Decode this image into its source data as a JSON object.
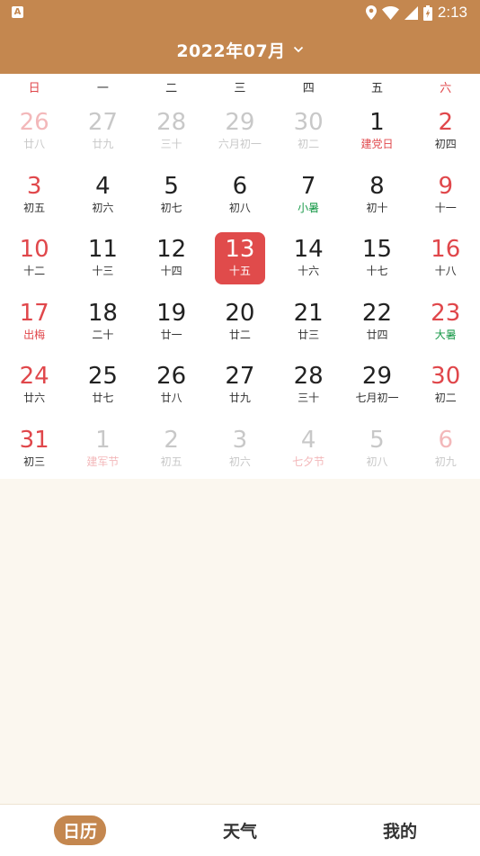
{
  "status": {
    "app_badge": "A",
    "time": "2:13"
  },
  "header": {
    "title": "2022年07月"
  },
  "weekdays": [
    "日",
    "一",
    "二",
    "三",
    "四",
    "五",
    "六"
  ],
  "days": [
    {
      "n": "26",
      "l": "廿八",
      "faded": true
    },
    {
      "n": "27",
      "l": "廿九",
      "faded": true
    },
    {
      "n": "28",
      "l": "三十",
      "faded": true
    },
    {
      "n": "29",
      "l": "六月初一",
      "faded": true
    },
    {
      "n": "30",
      "l": "初二",
      "faded": true
    },
    {
      "n": "1",
      "l": "建党日",
      "type": "fest"
    },
    {
      "n": "2",
      "l": "初四"
    },
    {
      "n": "3",
      "l": "初五"
    },
    {
      "n": "4",
      "l": "初六"
    },
    {
      "n": "5",
      "l": "初七"
    },
    {
      "n": "6",
      "l": "初八"
    },
    {
      "n": "7",
      "l": "小暑",
      "type": "term"
    },
    {
      "n": "8",
      "l": "初十"
    },
    {
      "n": "9",
      "l": "十一"
    },
    {
      "n": "10",
      "l": "十二"
    },
    {
      "n": "11",
      "l": "十三"
    },
    {
      "n": "12",
      "l": "十四"
    },
    {
      "n": "13",
      "l": "十五",
      "today": true
    },
    {
      "n": "14",
      "l": "十六"
    },
    {
      "n": "15",
      "l": "十七"
    },
    {
      "n": "16",
      "l": "十八"
    },
    {
      "n": "17",
      "l": "出梅",
      "type": "fest"
    },
    {
      "n": "18",
      "l": "二十"
    },
    {
      "n": "19",
      "l": "廿一"
    },
    {
      "n": "20",
      "l": "廿二"
    },
    {
      "n": "21",
      "l": "廿三"
    },
    {
      "n": "22",
      "l": "廿四"
    },
    {
      "n": "23",
      "l": "大暑",
      "type": "term"
    },
    {
      "n": "24",
      "l": "廿六"
    },
    {
      "n": "25",
      "l": "廿七"
    },
    {
      "n": "26",
      "l": "廿八"
    },
    {
      "n": "27",
      "l": "廿九"
    },
    {
      "n": "28",
      "l": "三十"
    },
    {
      "n": "29",
      "l": "七月初一"
    },
    {
      "n": "30",
      "l": "初二"
    },
    {
      "n": "31",
      "l": "初三"
    },
    {
      "n": "1",
      "l": "建军节",
      "faded": true,
      "type": "fest"
    },
    {
      "n": "2",
      "l": "初五",
      "faded": true
    },
    {
      "n": "3",
      "l": "初六",
      "faded": true
    },
    {
      "n": "4",
      "l": "七夕节",
      "faded": true,
      "type": "fest"
    },
    {
      "n": "5",
      "l": "初八",
      "faded": true
    },
    {
      "n": "6",
      "l": "初九",
      "faded": true
    }
  ],
  "nav": [
    {
      "label": "日历",
      "active": true
    },
    {
      "label": "天气"
    },
    {
      "label": "我的"
    }
  ],
  "colors": {
    "brand": "#c4874f",
    "accent_red": "#e04b4b",
    "term_green": "#1a9a4a"
  }
}
